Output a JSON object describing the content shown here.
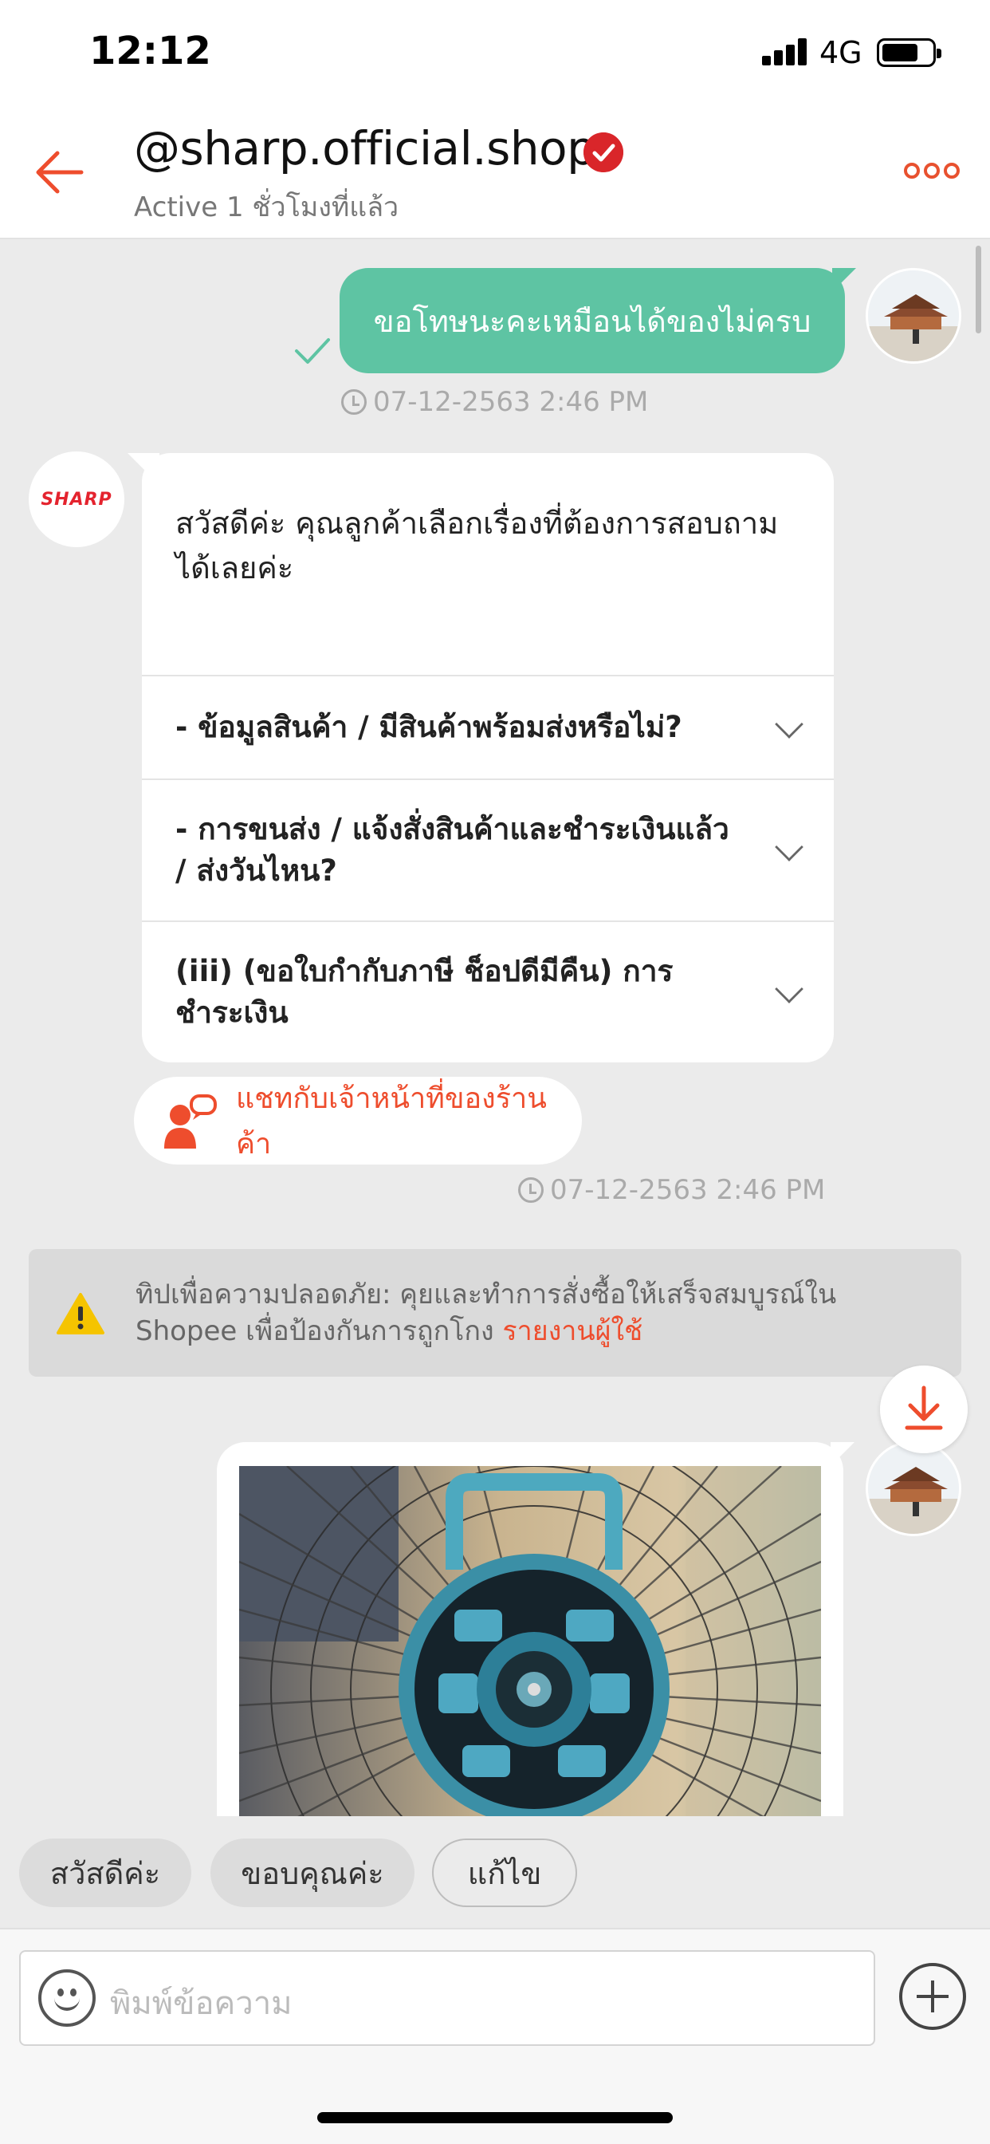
{
  "status_bar": {
    "time": "12:12",
    "network": "4G"
  },
  "header": {
    "shop_name": "@sharp.official.shop",
    "status": "Active 1 ชั่วโมงที่แล้ว"
  },
  "messages": {
    "outgoing_text": "ขอโทษนะคะเหมือนได้ของไม่ครบ",
    "outgoing_time": "07-12-2563 2:46 PM",
    "shop_avatar_text": "SHARP",
    "card": {
      "greeting": "สวัสดีค่ะ คุณลูกค้าเลือกเรื่องที่ต้องการสอบถามได้เลยค่ะ",
      "options": [
        "- ข้อมูลสินค้า / มีสินค้าพร้อมส่งหรือไม่?",
        "- การขนส่ง / แจ้งสั่งสินค้าและชำระเงินแล้ว / ส่งวันไหน?",
        "(iii) (ขอใบกำกับภาษี ช็อปดีมีคืน) การชำระเงิน"
      ]
    },
    "agent_button": "แชทกับเจ้าหน้าที่ของร้านค้า",
    "card_time": "07-12-2563 2:46 PM"
  },
  "tip": {
    "text": "ทิปเพื่อความปลอดภัย: คุยและทำการสั่งซื้อให้เสร็จสมบูรณ์ใน Shopee เพื่อป้องกันการถูกโกง",
    "link": "รายงานผู้ใช้"
  },
  "quick_replies": [
    "สวัสดีค่ะ",
    "ขอบคุณค่ะ",
    "แก้ไข"
  ],
  "input": {
    "placeholder": "พิมพ์ข้อความ"
  },
  "colors": {
    "accent": "#ee4d2d",
    "outgoing_bubble": "#5ec4a3",
    "brand_red": "#e4232e"
  },
  "icons": [
    "back-arrow-icon",
    "verified-badge-icon",
    "more-icon",
    "sent-check-icon",
    "clock-icon",
    "chevron-down-icon",
    "agent-chat-icon",
    "warning-icon",
    "download-icon",
    "emoji-icon",
    "plus-icon"
  ]
}
